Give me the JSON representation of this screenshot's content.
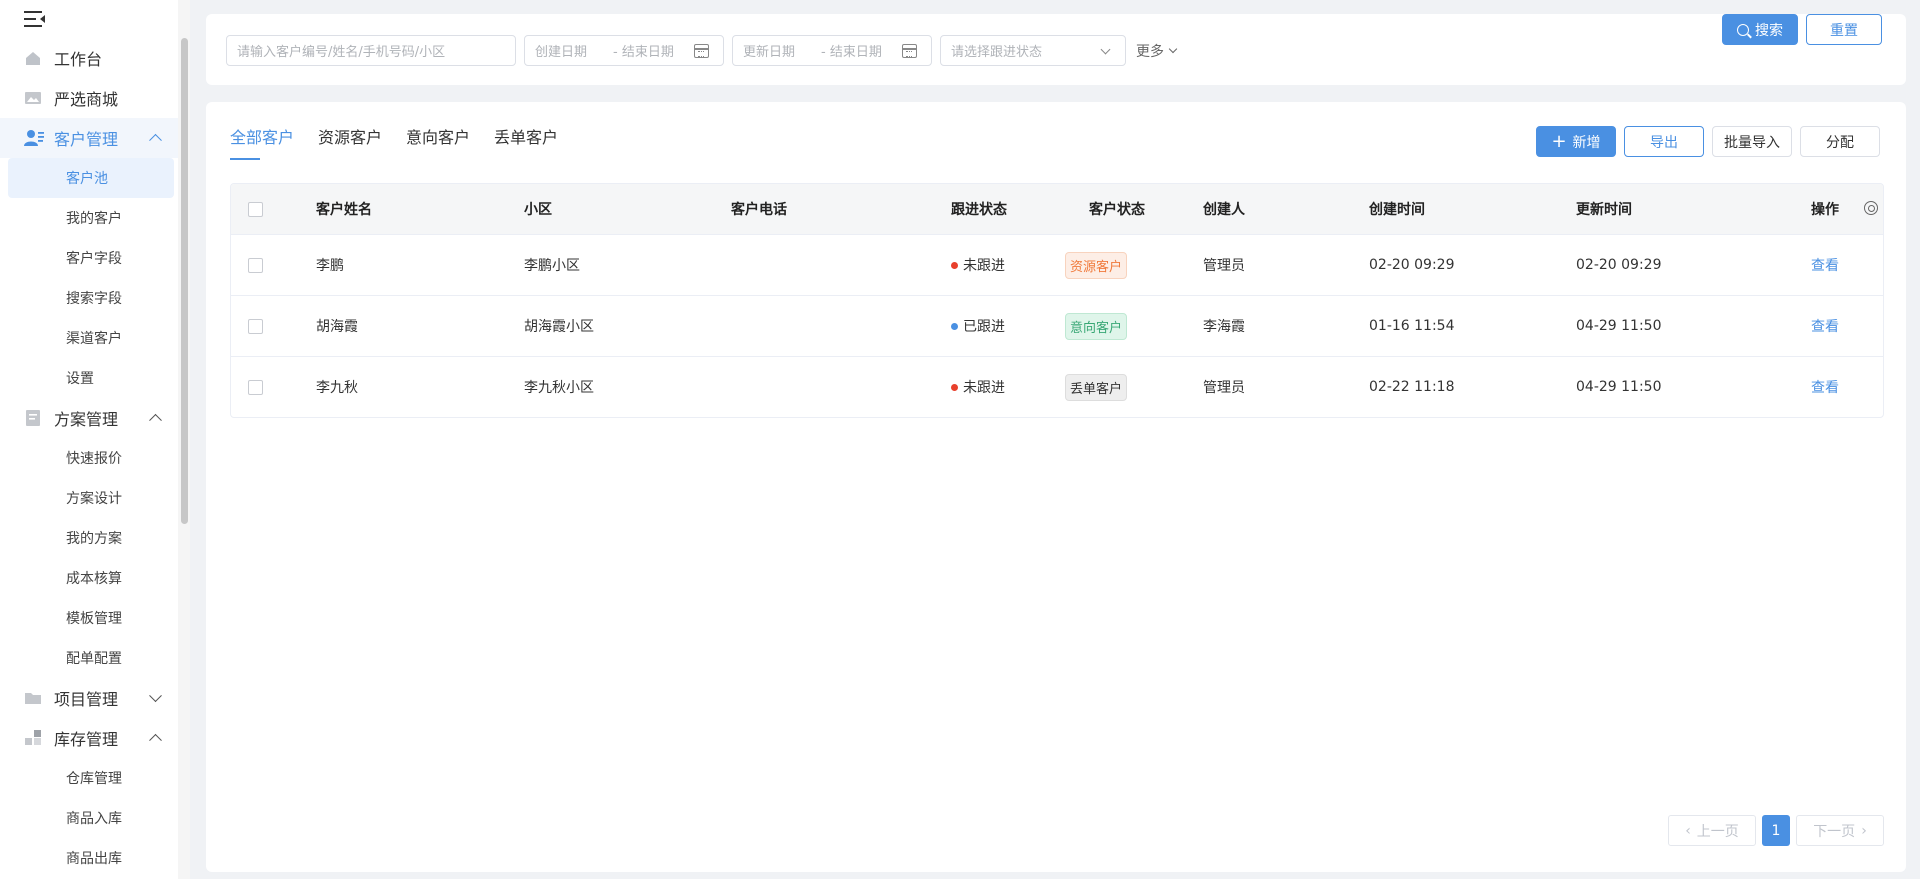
{
  "sidebar": {
    "items": [
      {
        "label": "工作台",
        "icon": "home-icon"
      },
      {
        "label": "严选商城",
        "icon": "image-icon"
      },
      {
        "label": "客户管理",
        "icon": "user-manage-icon",
        "expanded": true,
        "children": [
          "客户池",
          "我的客户",
          "客户字段",
          "搜索字段",
          "渠道客户",
          "设置"
        ]
      },
      {
        "label": "方案管理",
        "icon": "document-icon",
        "expanded": true,
        "children": [
          "快速报价",
          "方案设计",
          "我的方案",
          "成本核算",
          "模板管理",
          "配单配置"
        ]
      },
      {
        "label": "项目管理",
        "icon": "folder-icon",
        "expanded": false
      },
      {
        "label": "库存管理",
        "icon": "warehouse-icon",
        "expanded": true,
        "children": [
          "仓库管理",
          "商品入库",
          "商品出库"
        ]
      }
    ],
    "active_child": "客户池"
  },
  "filters": {
    "keyword_placeholder": "请输入客户编号/姓名/手机号码/小区",
    "create_date_start": "创建日期",
    "create_date_end": "- 结束日期",
    "update_date_start": "更新日期",
    "update_date_end": "- 结束日期",
    "status_placeholder": "请选择跟进状态",
    "more": "更多",
    "search": "搜索",
    "reset": "重置"
  },
  "tabs": [
    "全部客户",
    "资源客户",
    "意向客户",
    "丢单客户"
  ],
  "actions": {
    "add": "新增",
    "export": "导出",
    "import": "批量导入",
    "assign": "分配"
  },
  "table": {
    "columns": [
      "客户姓名",
      "小区",
      "客户电话",
      "跟进状态",
      "客户状态",
      "创建人",
      "创建时间",
      "更新时间",
      "操作"
    ],
    "rows": [
      {
        "name": "李鹏",
        "community": "李鹏小区",
        "phone": "",
        "follow": "未跟进",
        "status": "资源客户",
        "creator": "管理员",
        "created": "02-20 09:29",
        "updated": "02-20 09:29",
        "action": "查看"
      },
      {
        "name": "胡海霞",
        "community": "胡海霞小区",
        "phone": "",
        "follow": "已跟进",
        "status": "意向客户",
        "creator": "李海霞",
        "created": "01-16 11:54",
        "updated": "04-29 11:50",
        "action": "查看"
      },
      {
        "name": "李九秋",
        "community": "李九秋小区",
        "phone": "",
        "follow": "未跟进",
        "status": "丢单客户",
        "creator": "管理员",
        "created": "02-22 11:18",
        "updated": "04-29 11:50",
        "action": "查看"
      }
    ]
  },
  "pagination": {
    "prev": "上一页",
    "current": "1",
    "next": "下一页"
  },
  "colors": {
    "accent": "#4a90e2",
    "dot_unfollowed": "#e8402c",
    "dot_followed": "#4a90e2",
    "tag_resource_bg": "#fdeee6",
    "tag_resource_fg": "#f07a3c",
    "tag_intent_bg": "#dff5ea",
    "tag_intent_fg": "#3aa876",
    "tag_lost_bg": "#eeeeee",
    "tag_lost_fg": "#333333"
  }
}
